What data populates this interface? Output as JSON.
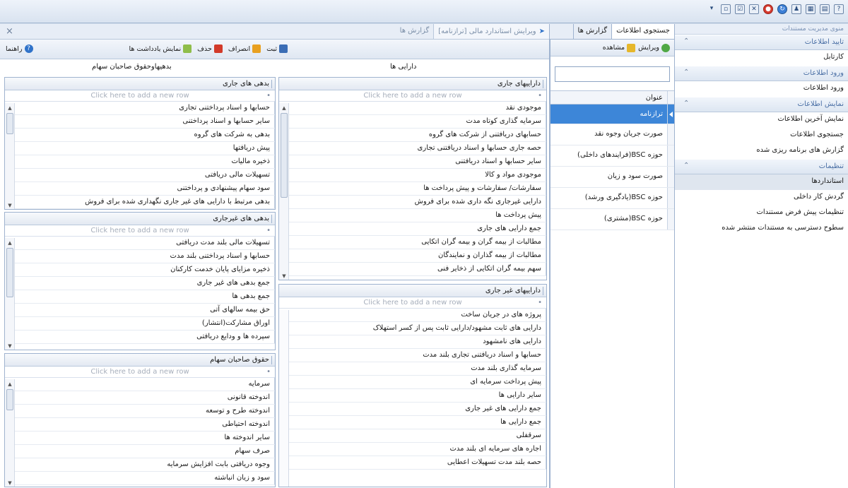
{
  "nav": {
    "title": "منوی مدیریت مستندات",
    "groups": [
      {
        "label": "تایید اطلاعات",
        "items": [
          "کارتابل"
        ]
      },
      {
        "label": "ورود اطلاعات",
        "items": [
          "ورود اطلاعات"
        ]
      },
      {
        "label": "نمایش اطلاعات",
        "items": [
          "نمایش آخرین اطلاعات",
          "جستجوی اطلاعات",
          "گزارش های برنامه ریزی شده"
        ]
      },
      {
        "label": "تنظیمات",
        "items": [
          "استانداردها",
          "گردش کار داخلی",
          "تنظیمات پیش فرض مستندات",
          "سطوح دسترسی به مستندات منتشر شده"
        ]
      }
    ]
  },
  "mid": {
    "tabs": [
      "جستجوی اطلاعات",
      "گزارش ها"
    ],
    "toolbar": {
      "edit": "ویرایش",
      "view": "مشاهده"
    },
    "column_header": "عنوان",
    "rows": [
      "ترازنامه",
      "صورت جریان وجوه نقد",
      "حوزه BSC(فرایندهای داخلی)",
      "صورت سود و زیان",
      "حوزه BSC(یادگیری ورشد)",
      "حوزه BSC(مشتری)"
    ]
  },
  "editor": {
    "tab_title": "ویرایش استاندارد مالی [ترازنامه]",
    "tab_title2": "گزارش ها",
    "toolbar": {
      "save": "ثبت",
      "cancel": "انصراف",
      "delete": "حذف",
      "show_note": "نمایش یادداشت ها",
      "help": "راهنما"
    },
    "caption_left": "بدهیهاوحقوق صاحبان سهام",
    "caption_right": "دارایی ها",
    "add_row_text": "Click here to add a new row",
    "panels": {
      "current_liabilities": {
        "title": "بدهی های جاری",
        "rows": [
          "حسابها و اسناد پرداختنی تجاری",
          "سایر حسابها و اسناد پرداختنی",
          "بدهی به شرکت های گروه",
          "پیش دریافتها",
          "ذخیره مالیات",
          "تسهیلات مالی دریافتی",
          "سود سهام پیشنهادی و پرداختنی",
          "بدهی مرتبط با دارایی های غیر جاری نگهداری شده برای فروش"
        ]
      },
      "noncurrent_liabilities": {
        "title": "بدهی های غیرجاری",
        "rows": [
          "تسهیلات مالی بلند مدت دریافتی",
          "حسابها و اسناد پرداختنی بلند مدت",
          "ذخیره مزایای پایان خدمت کارکنان",
          "جمع بدهی های غیر جاری",
          "جمع بدهی ها",
          "حق بیمه سالهای آتی",
          "اوراق مشارکت(انتشار)",
          "سپرده ها و ودایع دریافتی"
        ]
      },
      "equity": {
        "title": "حقوق صاحبان سهام",
        "rows": [
          "سرمایه",
          "اندوخته قانونی",
          "اندوخته طرح و توسعه",
          "اندوخته احتیاطی",
          "سایر اندوخته ها",
          "صرف سهام",
          "وجوه دریافتی بابت افزایش سرمایه",
          "سود و زیان انباشته"
        ]
      },
      "current_assets": {
        "title": "داراییهای جاری",
        "rows": [
          "موجودی نقد",
          "سرمایه گذاری کوتاه مدت",
          "حسابهای دریافتنی از شرکت های گروه",
          "حصه جاری حسابها و اسناد دریافتنی تجاری",
          "سایر حسابها و اسناد دریافتنی",
          "موجودی مواد و کالا",
          "سفارشات/ سفارشات و پیش پرداخت ها",
          "دارایی غیرجاری نگه داری شده برای فروش",
          "پیش پرداخت ها",
          "جمع دارایی های جاری",
          "مطالبات از بیمه گران و بیمه گران اتکایی",
          "مطالبات از بیمه گذاران و نمایندگان",
          "سهم بیمه گران اتکایی از ذخایر فنی"
        ]
      },
      "noncurrent_assets": {
        "title": "داراییهای غیر جاری",
        "rows": [
          "پروژه های در جریان ساخت",
          "دارایی های ثابت مشهود/دارایی ثابت پس از کسر استهلاک",
          "دارایی های نامشهود",
          "حسابها و اسناد دریافتنی تجاری بلند مدت",
          "سرمایه گذاری بلند مدت",
          "پیش پرداخت سرمایه ای",
          "سایر دارایی ها",
          "جمع دارایی های غیر جاری",
          "جمع دارایی ها",
          "سرقفلی",
          "اجاره های سرمایه ای بلند مدت",
          "حصه بلند مدت تسهیلات اعطایی"
        ]
      }
    }
  }
}
